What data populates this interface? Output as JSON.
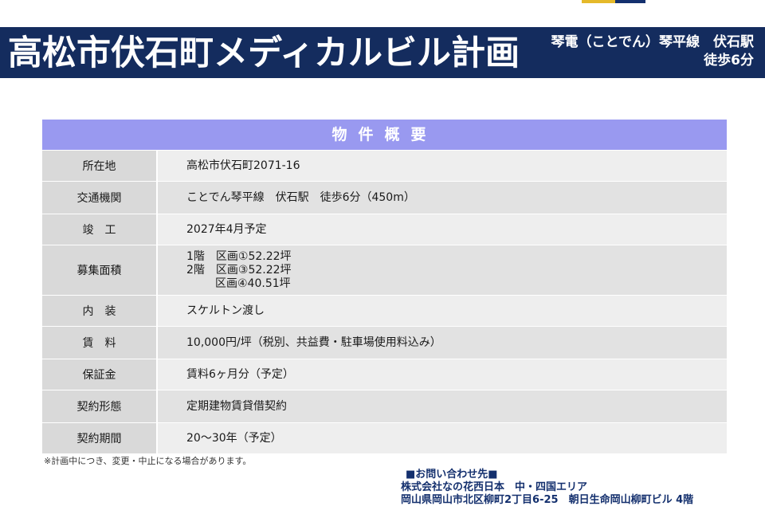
{
  "banner": {
    "title": "高松市伏石町メディカルビル計画",
    "line": "琴電（ことでん）琴平線　伏石駅",
    "walk": "徒歩6分"
  },
  "table": {
    "header": "物件概要",
    "rows": [
      {
        "label": "所在地",
        "value": "高松市伏石町2071-16"
      },
      {
        "label": "交通機関",
        "value": "ことでん琴平線　伏石駅　徒歩6分（450m）"
      },
      {
        "label": "竣　工",
        "value": "2027年4月予定"
      },
      {
        "label": "募集面積",
        "lines": [
          "1階　区画①52.22坪",
          "2階　区画③52.22坪",
          "区画④40.51坪"
        ]
      },
      {
        "label": "内　装",
        "value": "スケルトン渡し"
      },
      {
        "label": "賃　料",
        "value": "10,000円/坪（税別、共益費・駐車場使用料込み）"
      },
      {
        "label": "保証金",
        "value": "賃料6ヶ月分（予定）"
      },
      {
        "label": "契約形態",
        "value": "定期建物賃貸借契約"
      },
      {
        "label": "契約期間",
        "value": "20〜30年（予定）"
      }
    ]
  },
  "note": "※計画中につき、変更・中止になる場合があります。",
  "contact": {
    "heading": "■お問い合わせ先■",
    "company": "株式会社なの花西日本　中・四国エリア",
    "address": "岡山県岡山市北区柳町2丁目6-25　朝日生命岡山柳町ビル 4階"
  },
  "colors": {
    "banner": "#142c5e",
    "table_header": "#9999f0",
    "label_cell": "#d9d9d9",
    "value_cell": "#eeeeee"
  }
}
